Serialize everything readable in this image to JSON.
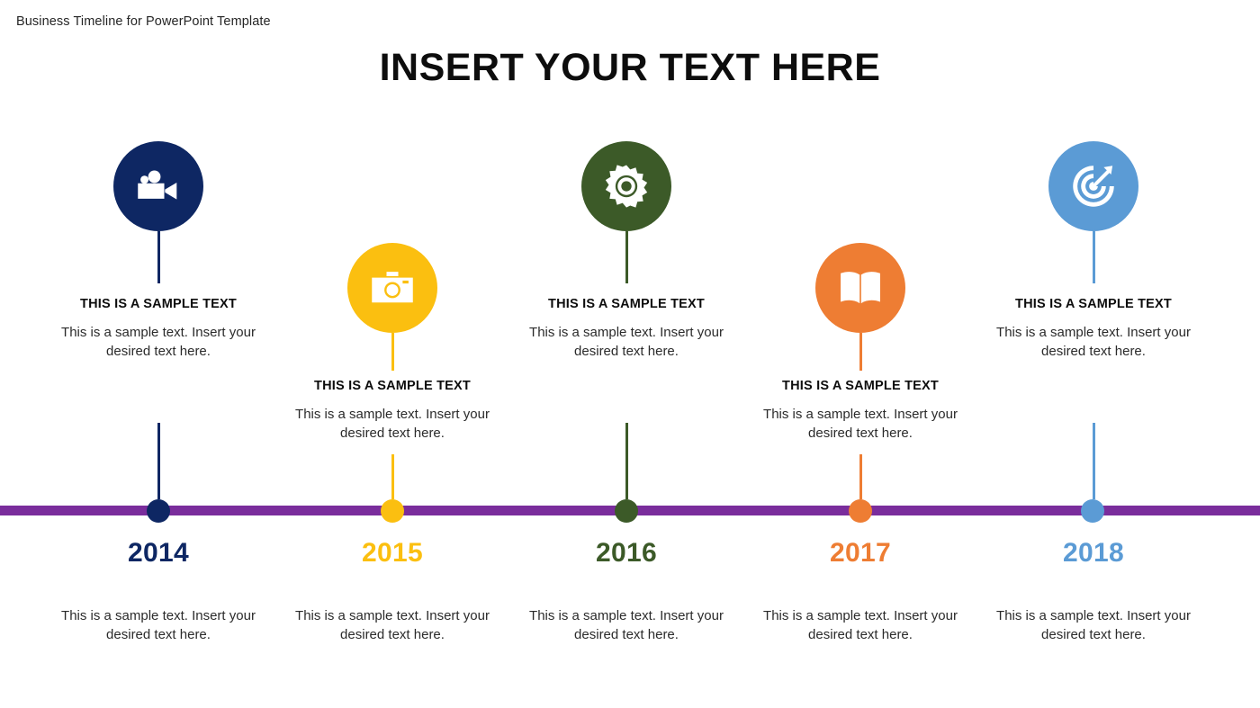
{
  "header": {
    "label": "Business Timeline for PowerPoint Template"
  },
  "title": "INSERT YOUR TEXT HERE",
  "timeline": {
    "axis_color": "#7a2d9c",
    "milestones": [
      {
        "year": "2014",
        "color": "#0e2763",
        "icon": "video-camera-icon",
        "position": "high",
        "heading": "THIS IS A SAMPLE TEXT",
        "body": "This is a sample text. Insert your desired text here.",
        "bottom_body": "This is a sample text. Insert your desired text here."
      },
      {
        "year": "2015",
        "color": "#fbbf10",
        "icon": "photo-camera-icon",
        "position": "low",
        "heading": "THIS IS A SAMPLE TEXT",
        "body": "This is a sample text. Insert your desired text here.",
        "bottom_body": "This is a sample text. Insert your desired text here."
      },
      {
        "year": "2016",
        "color": "#3c5a28",
        "icon": "gear-icon",
        "position": "high",
        "heading": "THIS IS A SAMPLE TEXT",
        "body": "This is a sample text. Insert your desired text here.",
        "bottom_body": "This is a sample text. Insert your desired text here."
      },
      {
        "year": "2017",
        "color": "#ee7d33",
        "icon": "open-book-icon",
        "position": "low",
        "heading": "THIS IS A SAMPLE TEXT",
        "body": "This is a sample text. Insert your desired text here.",
        "bottom_body": "This is a sample text. Insert your desired text here."
      },
      {
        "year": "2018",
        "color": "#5b9bd5",
        "icon": "target-arrow-icon",
        "position": "high",
        "heading": "THIS IS A SAMPLE TEXT",
        "body": "This is a sample text. Insert your desired text here.",
        "bottom_body": "This is a sample text. Insert your desired text here."
      }
    ]
  }
}
